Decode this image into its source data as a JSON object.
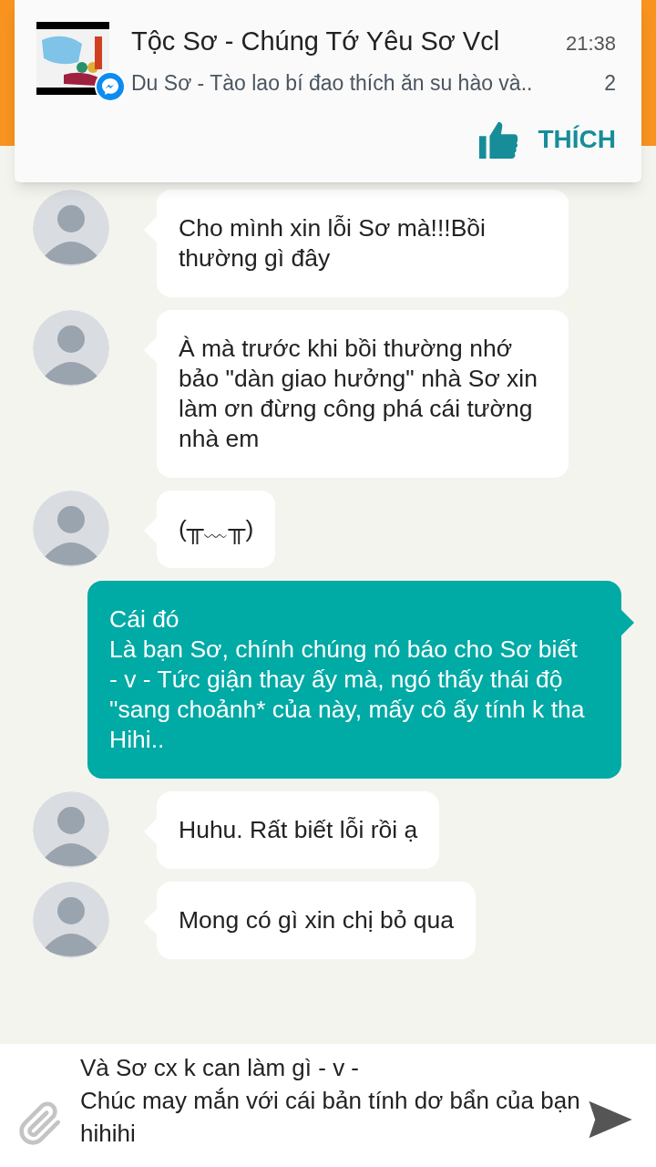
{
  "notification": {
    "title": "Tộc Sơ - Chúng Tớ Yêu Sơ Vcl",
    "time": "21:38",
    "preview": "Du Sơ - Tào lao bí đao thích ăn su hào và..",
    "count": "2",
    "action": "THÍCH"
  },
  "messages": [
    {
      "kind": "incoming",
      "text": "Cho mình xin lỗi Sơ mà!!!Bồi thường gì đây"
    },
    {
      "kind": "incoming",
      "text": "À mà trước khi bồi thường nhớ bảo \"dàn giao hưởng\" nhà Sơ xin làm ơn đừng công phá cái tường nhà em"
    },
    {
      "kind": "incoming",
      "text": "(╥﹏╥)"
    },
    {
      "kind": "outgoing",
      "text": "Cái đó\nLà bạn Sơ, chính chúng nó báo cho Sơ biết\n- v - Tức giận thay ấy mà, ngó thấy thái độ \"sang choảnh* của này, mấy cô ấy tính k tha\nHihi.."
    },
    {
      "kind": "incoming",
      "text": "Huhu. Rất biết lỗi rồi ạ"
    },
    {
      "kind": "incoming",
      "text": "Mong có gì xin chị bỏ qua"
    }
  ],
  "composer": {
    "value": "Và Sơ cx k can làm gì - v -\nChúc may mắn với cái bản tính dơ bẩn của bạn hihihi"
  }
}
